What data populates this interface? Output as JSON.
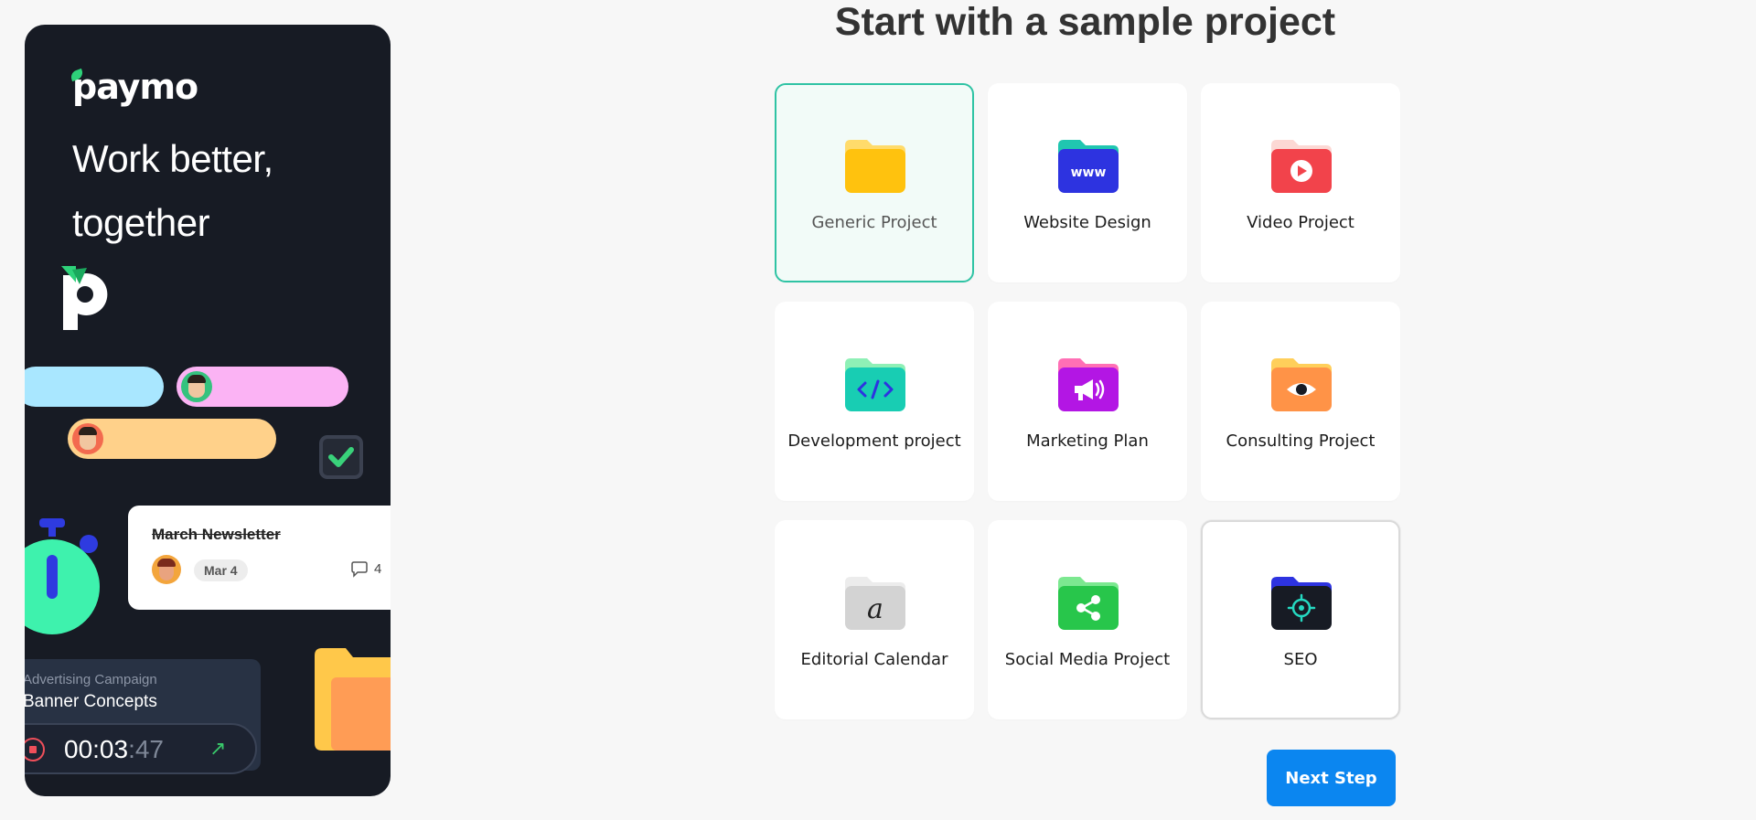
{
  "promo": {
    "logo": "paymo",
    "tagline": "Work better,\ntogether",
    "task_card": {
      "title": "March Newsletter",
      "date": "Mar 4",
      "comments": "4"
    },
    "timer_card": {
      "project": "Advertising Campaign",
      "task": "Banner Concepts",
      "time_main": "00:03",
      "time_seconds": ":47"
    }
  },
  "main": {
    "heading": "Start with a sample project",
    "selected": "Generic Project",
    "projects": [
      {
        "label": "Generic Project",
        "icon": "yellow-folder-icon",
        "color": "#FFC20E"
      },
      {
        "label": "Website Design",
        "icon": "www-folder-icon",
        "color": "#2D33E0"
      },
      {
        "label": "Video Project",
        "icon": "play-folder-icon",
        "color": "#F2434B"
      },
      {
        "label": "Development project",
        "icon": "code-folder-icon",
        "color": "#18CDB3"
      },
      {
        "label": "Marketing Plan",
        "icon": "megaphone-folder-icon",
        "color": "#B316E4"
      },
      {
        "label": "Consulting Project",
        "icon": "eye-folder-icon",
        "color": "#FF9347"
      },
      {
        "label": "Editorial Calendar",
        "icon": "pen-folder-icon",
        "color": "#D3D3D3"
      },
      {
        "label": "Social Media Project",
        "icon": "share-folder-icon",
        "color": "#28C64B"
      },
      {
        "label": "SEO",
        "icon": "target-folder-icon",
        "color": "#171B24"
      }
    ],
    "next_button": "Next Step"
  }
}
